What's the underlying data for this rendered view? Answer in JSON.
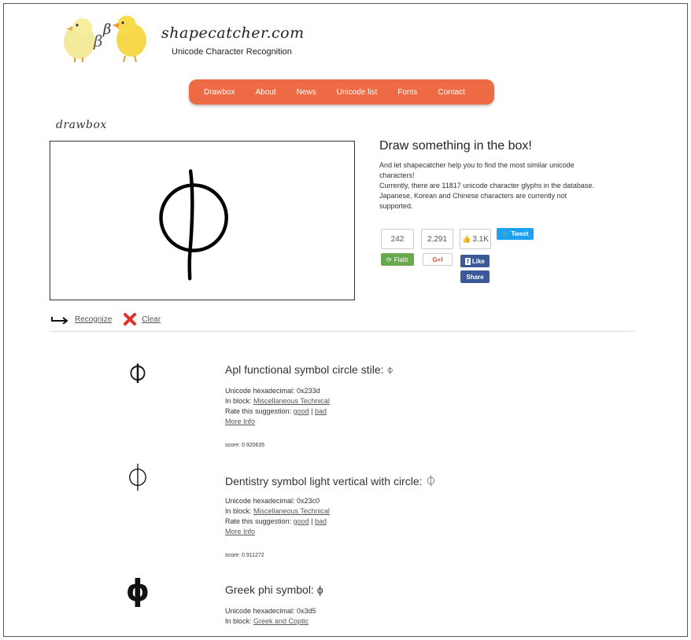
{
  "header": {
    "site_title": "shapecatcher.com",
    "subtitle": "Unicode Character Recognition",
    "logo_glyph": "β"
  },
  "nav": {
    "items": [
      "Drawbox",
      "About",
      "News",
      "Unicode list",
      "Fonts",
      "Contact"
    ],
    "color": "#ee6a44"
  },
  "drawbox": {
    "label": "drawbox",
    "recognize_label": "Recognize",
    "clear_label": "Clear"
  },
  "info": {
    "heading": "Draw something in the box!",
    "lines": [
      "And let shapecatcher help you to find the most similar unicode",
      "characters!",
      "Currently, there are 11817 unicode character glyphs in the database.",
      "Japanese, Korean and Chinese characters are currently not",
      "supported."
    ]
  },
  "social": {
    "flattr_count": "242",
    "flattr_label": "Flattr",
    "gplus_count": "2,291",
    "gplus_label": "G+I",
    "like_count": "3.1K",
    "like_label": "Like",
    "share_label": "Share",
    "tweet_label": "Tweet"
  },
  "results": [
    {
      "glyph": "⌽",
      "title": "Apl functional symbol circle stile: ⌽",
      "hex_label": "Unicode hexadecimal: 0x233d",
      "block_prefix": "In block: ",
      "block": "Miscellaneous Technical",
      "rate_prefix": "Rate this suggestion: ",
      "good": "good",
      "sep": " | ",
      "bad": "bad",
      "more": "More Info",
      "score": "score: 0.920635"
    },
    {
      "glyph": "⏀",
      "title": "Dentistry symbol light vertical with circle: ⏀",
      "hex_label": "Unicode hexadecimal: 0x23c0",
      "block_prefix": "In block: ",
      "block": "Miscellaneous Technical",
      "rate_prefix": "Rate this suggestion: ",
      "good": "good",
      "sep": " | ",
      "bad": "bad",
      "more": "More Info",
      "score": "score: 0.911272"
    },
    {
      "glyph": "ϕ",
      "title": "Greek phi symbol: ϕ",
      "hex_label": "Unicode hexadecimal: 0x3d5",
      "block_prefix": "In block: ",
      "block": "Greek and Coptic"
    }
  ]
}
